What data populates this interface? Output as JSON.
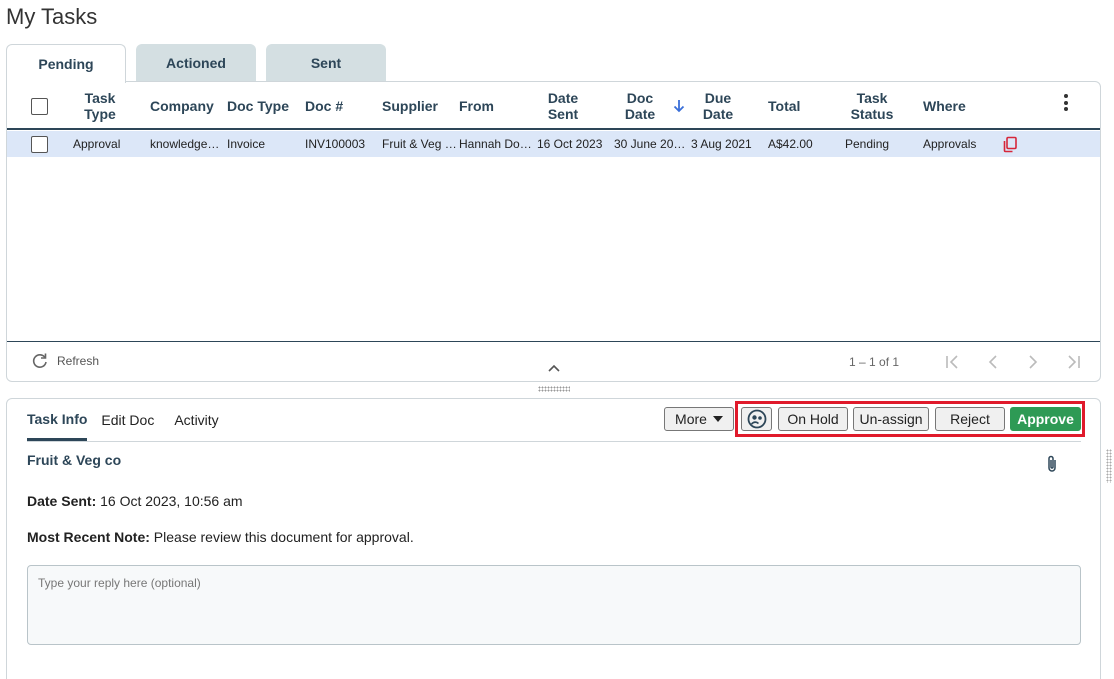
{
  "page": {
    "title": "My Tasks"
  },
  "tabs": [
    {
      "label": "Pending",
      "active": true
    },
    {
      "label": "Actioned",
      "active": false
    },
    {
      "label": "Sent",
      "active": false
    }
  ],
  "grid": {
    "columns": {
      "task_type": "Task Type",
      "company": "Company",
      "doc_type": "Doc Type",
      "doc_no": "Doc #",
      "supplier": "Supplier",
      "from": "From",
      "date_sent": "Date Sent",
      "doc_date": "Doc Date",
      "due_date": "Due Date",
      "total": "Total",
      "task_status": "Task Status",
      "where": "Where"
    },
    "sort": {
      "column": "Doc Date",
      "direction": "descending"
    },
    "rows": [
      {
        "task_type": "Approval",
        "company": "knowledge…",
        "doc_type": "Invoice",
        "doc_no": "INV100003",
        "supplier": "Fruit & Veg …",
        "from": "Hannah Do…",
        "date_sent": "16 Oct 2023",
        "doc_date": "30 June 20…",
        "due_date": "3 Aug 2021",
        "total": "A$42.00",
        "task_status": "Pending",
        "where": "Approvals",
        "icon": "copy-icon"
      }
    ],
    "footer": {
      "refresh_label": "Refresh",
      "paging": "1 – 1 of 1"
    }
  },
  "detail": {
    "tabs": [
      {
        "label": "Task Info",
        "active": true
      },
      {
        "label": "Edit Doc",
        "active": false
      },
      {
        "label": "Activity",
        "active": false
      }
    ],
    "actions": {
      "more": "More",
      "on_hold": "On Hold",
      "unassign": "Un-assign",
      "reject": "Reject",
      "approve": "Approve"
    },
    "supplier_name": "Fruit & Veg co",
    "date_sent_label": "Date Sent:",
    "date_sent_value": "16 Oct 2023, 10:56 am",
    "note_label": "Most Recent Note:",
    "note_value": "Please review this document for approval.",
    "reply_placeholder": "Type your reply here (optional)"
  },
  "colors": {
    "accent": "#2d4658",
    "approve": "#2e9a55",
    "highlight": "#e01a2b",
    "selected_row": "#dce7f8",
    "inactive_tab": "#d4dfe2"
  }
}
